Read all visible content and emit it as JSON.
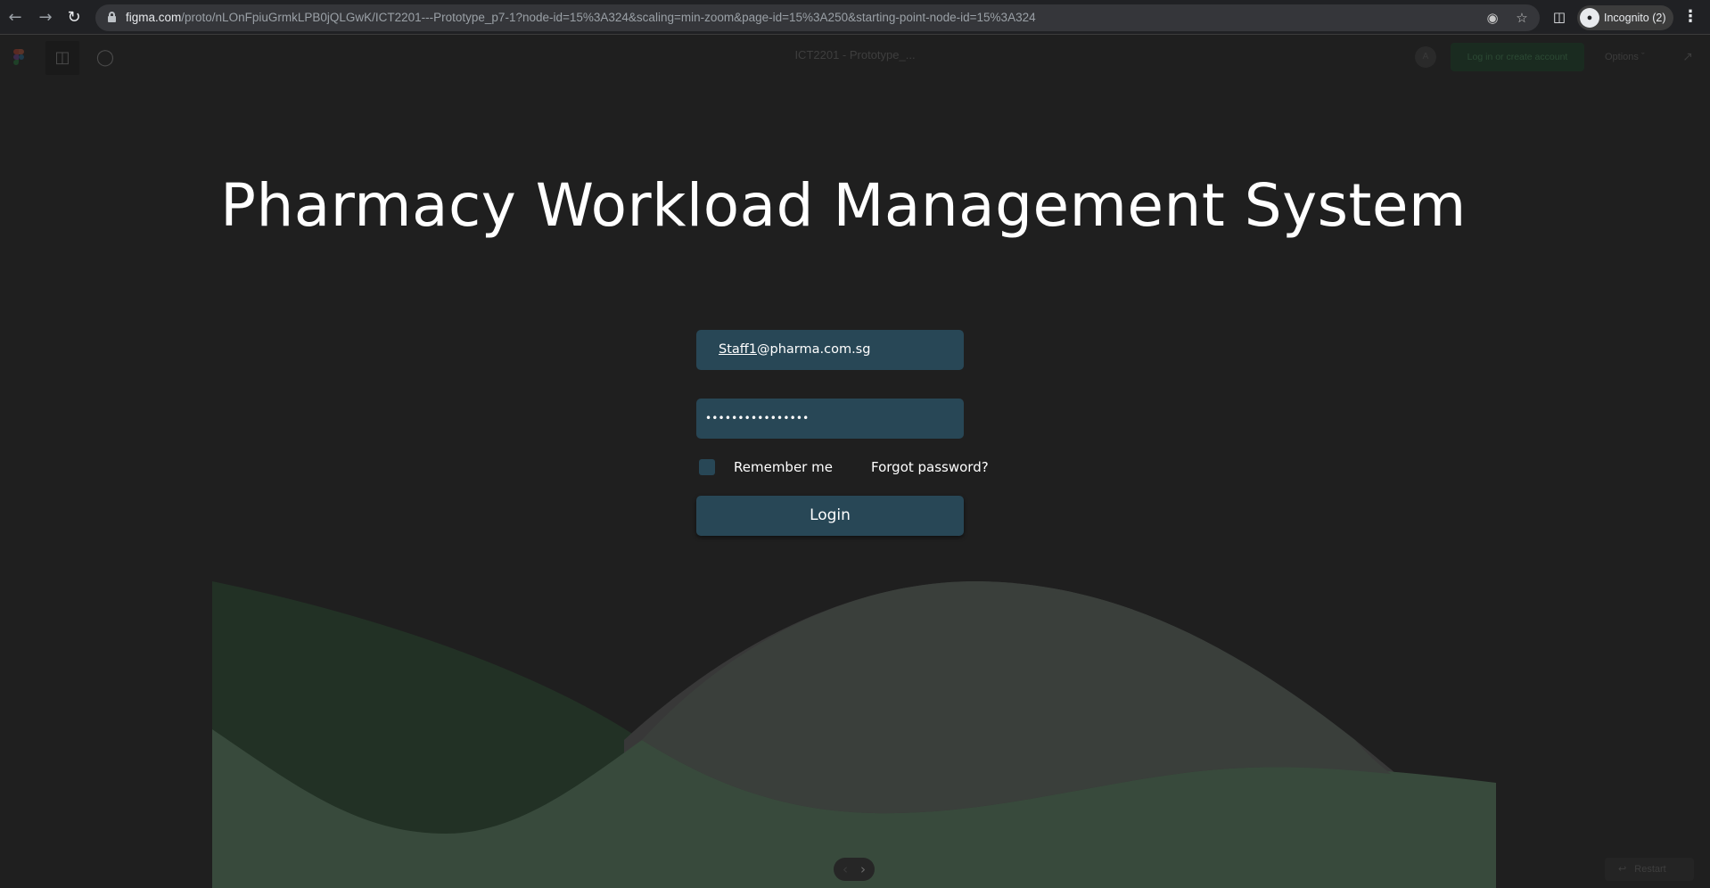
{
  "browser": {
    "url_host": "figma.com",
    "url_path": "/proto/nLOnFpiuGrmkLPB0jQLGwK/ICT2201---Prototype_p7-1?node-id=15%3A324&scaling=min-zoom&page-id=15%3A250&starting-point-node-id=15%3A324",
    "profile_label": "Incognito (2)"
  },
  "figma": {
    "doc_title": "ICT2201 - Prototype_...",
    "user_initial": "A",
    "login_create_label": "Log in or create account",
    "options_label": "Options",
    "restart_label": "Restart"
  },
  "page": {
    "title": "Pharmacy Workload Management System",
    "email_value_underlined": "Staff1",
    "email_value_rest": "@pharma.com.sg",
    "password_mask": "••••••••••••••••",
    "remember_label": "Remember me",
    "forgot_label": "Forgot password?",
    "login_label": "Login"
  },
  "colors": {
    "background": "#1f1f1f",
    "field": "#284756",
    "wave_green_dark": "#223125",
    "wave_gray": "#383838",
    "wave_green_light": "#384a3c"
  },
  "icons": [
    "back-arrow-icon",
    "forward-arrow-icon",
    "reload-icon",
    "lock-icon",
    "eye-off-icon",
    "star-icon",
    "side-panel-icon",
    "incognito-icon",
    "more-vert-icon",
    "figma-logo-icon",
    "sidebar-toggle-icon",
    "comment-icon",
    "expand-icon",
    "chevron-left-icon",
    "chevron-right-icon",
    "restart-icon"
  ]
}
